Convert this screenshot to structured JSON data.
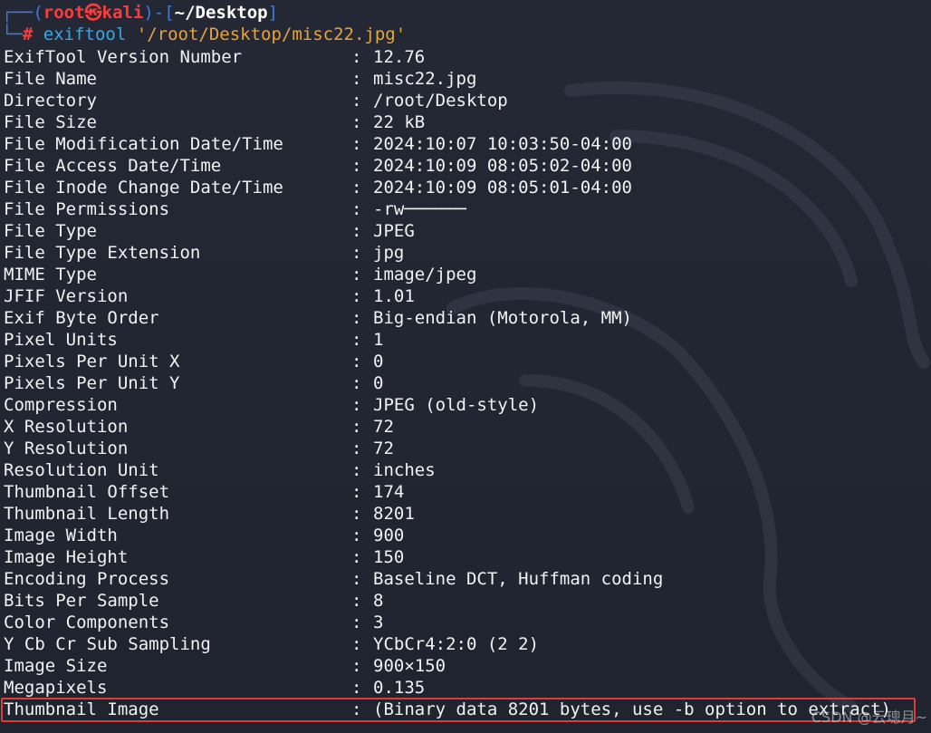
{
  "prompt": {
    "corner_top": "┌──(",
    "user": "root",
    "at_symbol": "㉿",
    "host": "kali",
    "mid": ")-[",
    "path": "~/Desktop",
    "end": "]",
    "corner_bottom": "└─",
    "hash": "#",
    "command": "exiftool",
    "argument": "'/root/Desktop/misc22.jpg'"
  },
  "rows": [
    {
      "key": "ExifTool Version Number",
      "value": "12.76"
    },
    {
      "key": "File Name",
      "value": "misc22.jpg"
    },
    {
      "key": "Directory",
      "value": "/root/Desktop"
    },
    {
      "key": "File Size",
      "value": "22 kB"
    },
    {
      "key": "File Modification Date/Time",
      "value": "2024:10:07 10:03:50-04:00"
    },
    {
      "key": "File Access Date/Time",
      "value": "2024:10:09 08:05:02-04:00"
    },
    {
      "key": "File Inode Change Date/Time",
      "value": "2024:10:09 08:05:01-04:00"
    },
    {
      "key": "File Permissions",
      "value": "-rw──────"
    },
    {
      "key": "File Type",
      "value": "JPEG"
    },
    {
      "key": "File Type Extension",
      "value": "jpg"
    },
    {
      "key": "MIME Type",
      "value": "image/jpeg"
    },
    {
      "key": "JFIF Version",
      "value": "1.01"
    },
    {
      "key": "Exif Byte Order",
      "value": "Big-endian (Motorola, MM)"
    },
    {
      "key": "Pixel Units",
      "value": "1"
    },
    {
      "key": "Pixels Per Unit X",
      "value": "0"
    },
    {
      "key": "Pixels Per Unit Y",
      "value": "0"
    },
    {
      "key": "Compression",
      "value": "JPEG (old-style)"
    },
    {
      "key": "X Resolution",
      "value": "72"
    },
    {
      "key": "Y Resolution",
      "value": "72"
    },
    {
      "key": "Resolution Unit",
      "value": "inches"
    },
    {
      "key": "Thumbnail Offset",
      "value": "174"
    },
    {
      "key": "Thumbnail Length",
      "value": "8201"
    },
    {
      "key": "Image Width",
      "value": "900"
    },
    {
      "key": "Image Height",
      "value": "150"
    },
    {
      "key": "Encoding Process",
      "value": "Baseline DCT, Huffman coding"
    },
    {
      "key": "Bits Per Sample",
      "value": "8"
    },
    {
      "key": "Color Components",
      "value": "3"
    },
    {
      "key": "Y Cb Cr Sub Sampling",
      "value": "YCbCr4:2:0 (2 2)"
    },
    {
      "key": "Image Size",
      "value": "900×150"
    },
    {
      "key": "Megapixels",
      "value": "0.135"
    },
    {
      "key": "Thumbnail Image",
      "value": "(Binary data 8201 bytes, use -b option to extract)"
    }
  ],
  "separator": ":",
  "watermark": "CSDN @云璁月~",
  "colors": {
    "background": "#232734",
    "prompt_frame": "#3f7bd8",
    "prompt_user": "#ff3b3b",
    "command": "#39a7e3",
    "argument": "#e8a33a",
    "highlight_box": "#e03a3a"
  }
}
